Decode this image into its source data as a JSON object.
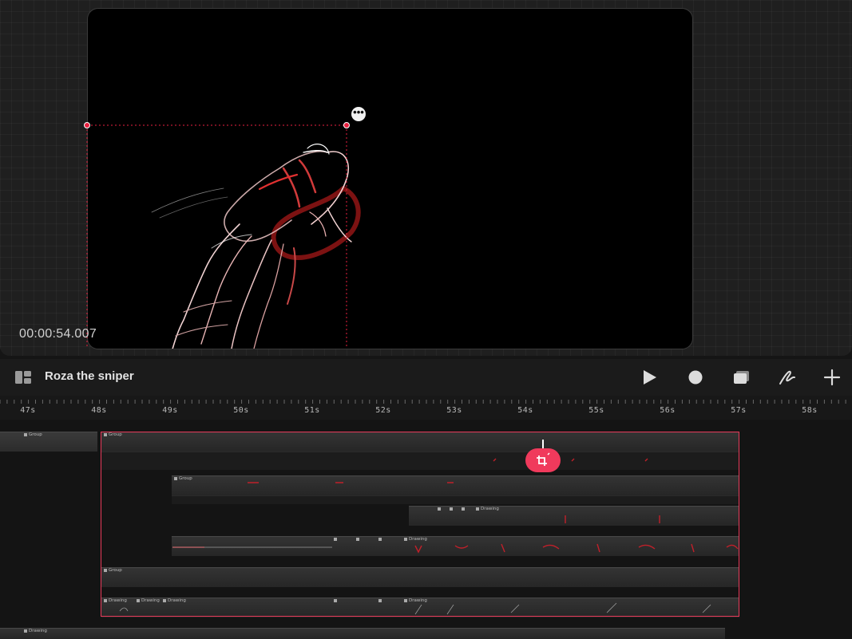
{
  "canvas": {
    "timecode": "00:00:54.007",
    "more_label": "•••"
  },
  "toolbar": {
    "project_title": "Roza the sniper",
    "icons": [
      "layout-icon",
      "play-icon",
      "record-icon",
      "layers-icon",
      "draw-icon",
      "add-icon"
    ]
  },
  "ruler": {
    "ticks": [
      "47s",
      "48s",
      "49s",
      "50s",
      "51s",
      "52s",
      "53s",
      "54s",
      "55s",
      "56s",
      "57s",
      "58s"
    ]
  },
  "timeline": {
    "group_label": "Group",
    "drawing_label": "Drawing",
    "accent_color": "#f03a5c"
  }
}
